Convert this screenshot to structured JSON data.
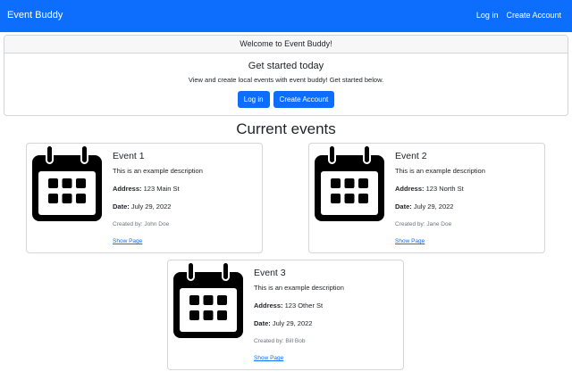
{
  "navbar": {
    "brand": "Event Buddy",
    "login": "Log in",
    "create_account": "Create Account"
  },
  "welcome": {
    "header": "Welcome to Event Buddy!",
    "title": "Get started today",
    "text": "View and create local events with event buddy! Get started below.",
    "login_button": "Log in",
    "create_button": "Create Account"
  },
  "section_title": "Current events",
  "events": [
    {
      "title": "Event 1",
      "description": "This is an example description",
      "address_label": "Address:",
      "address": "123 Main St",
      "date_label": "Date:",
      "date": "July 29, 2022",
      "created_by": "Created by: John Doe",
      "link": "Show Page",
      "icon": "calendar-icon"
    },
    {
      "title": "Event 2",
      "description": "This is an example description",
      "address_label": "Address:",
      "address": "123 North St",
      "date_label": "Date:",
      "date": "July 29, 2022",
      "created_by": "Created by: Jane Doe",
      "link": "Show Page",
      "icon": "calendar-icon"
    },
    {
      "title": "Event 3",
      "description": "This is an example description",
      "address_label": "Address:",
      "address": "123 Other St",
      "date_label": "Date:",
      "date": "July 29, 2022",
      "created_by": "Created by: Bill Bob",
      "link": "Show Page",
      "icon": "calendar-icon"
    }
  ],
  "colors": {
    "primary": "#0d6efd",
    "border": "#d3d6d9",
    "muted": "#6c757d"
  }
}
